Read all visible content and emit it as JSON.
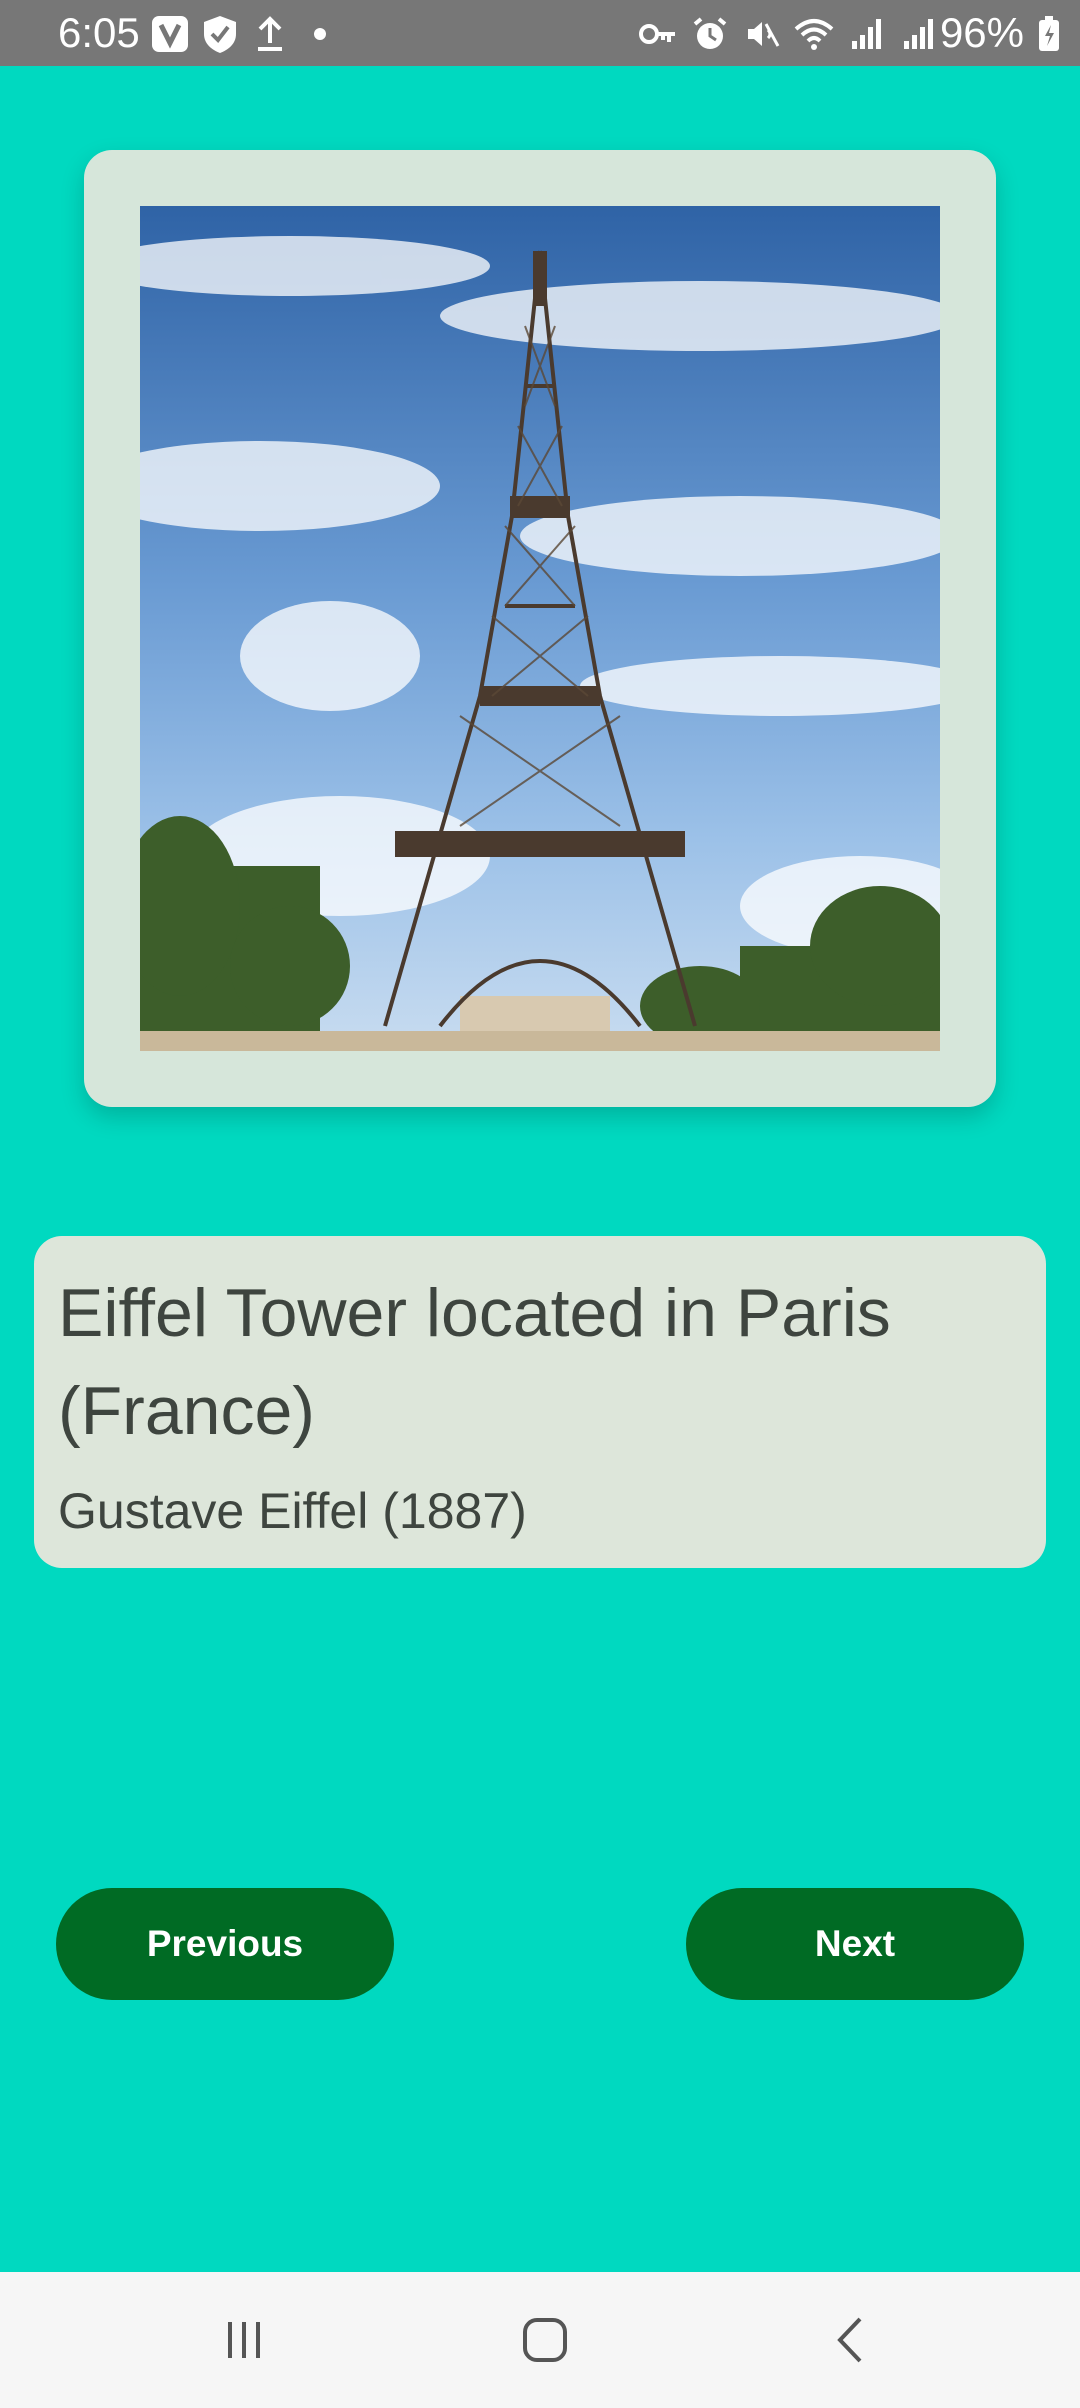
{
  "status_bar": {
    "time": "6:05",
    "battery": "96%",
    "left_icons": [
      "vpn-v-icon",
      "shield-check-icon",
      "upload-icon",
      "dot-icon"
    ],
    "right_icons": [
      "key-icon",
      "alarm-icon",
      "mute-icon",
      "wifi-icon",
      "signal-icon",
      "signal-icon"
    ]
  },
  "landmark": {
    "title": "Eiffel Tower located in Paris (France)",
    "subtitle": "Gustave Eiffel (1887)"
  },
  "buttons": {
    "previous": "Previous",
    "next": "Next"
  },
  "nav_bar": {
    "items": [
      "recent-apps-icon",
      "home-icon",
      "back-icon"
    ]
  },
  "colors": {
    "background": "#00d9c0",
    "button": "#006b24",
    "image_card": "#d6e6da",
    "text_card": "#dde6da"
  }
}
